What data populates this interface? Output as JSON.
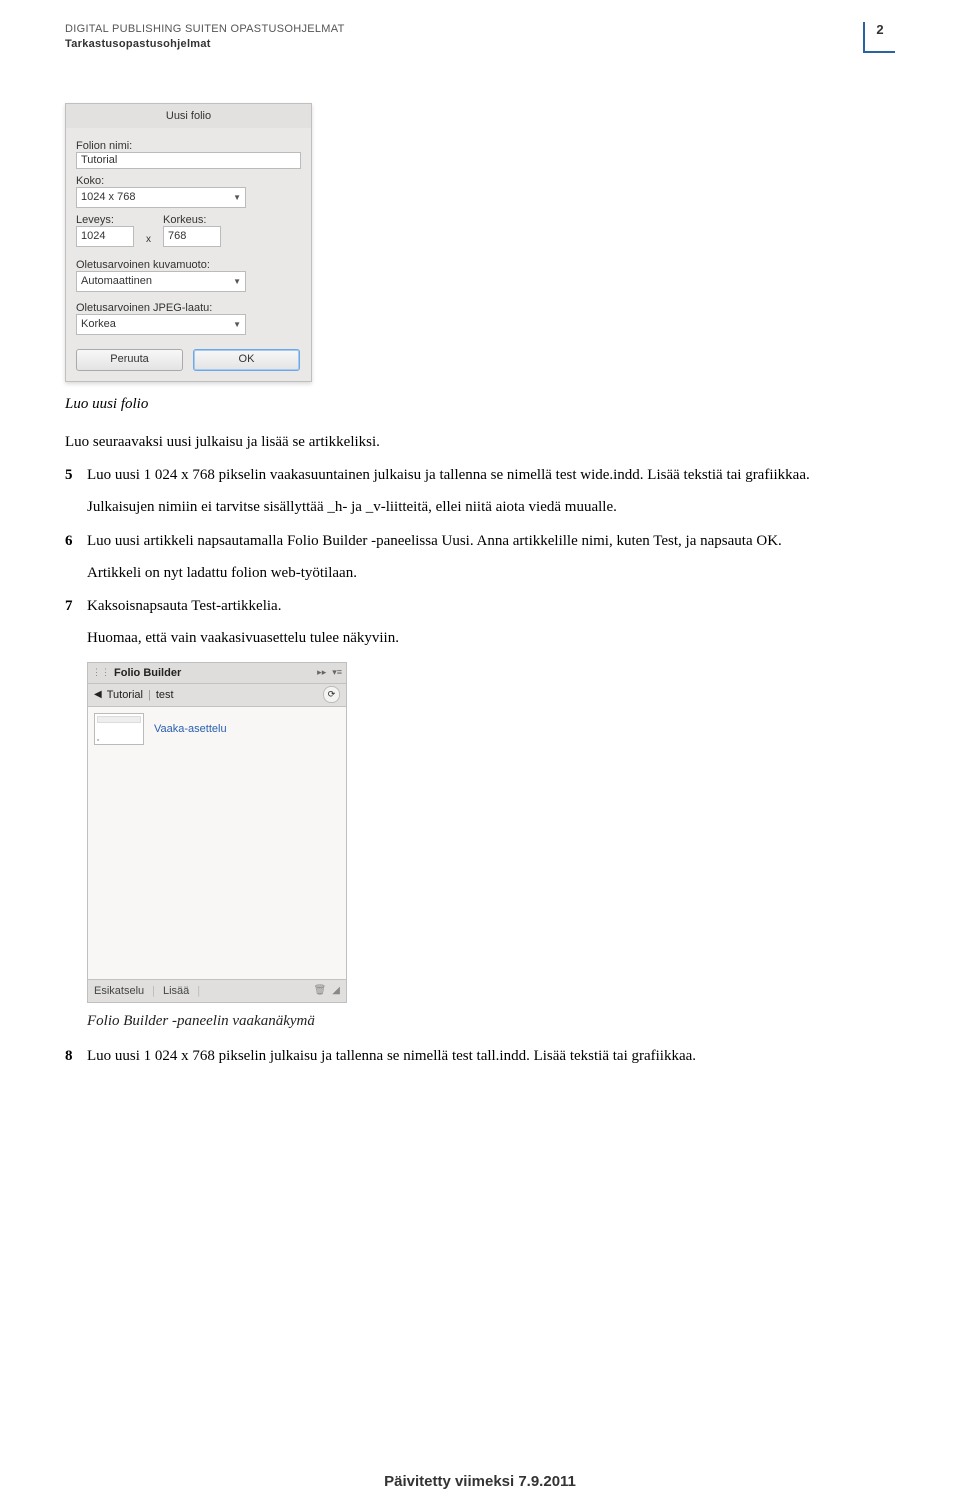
{
  "header": {
    "line1": "DIGITAL PUBLISHING SUITEN OPASTUSOHJELMAT",
    "line2": "Tarkastusopastusohjelmat",
    "page_number": "2"
  },
  "dialog": {
    "title": "Uusi folio",
    "name_label": "Folion nimi:",
    "name_value": "Tutorial",
    "size_label": "Koko:",
    "size_value": "1024 x 768",
    "width_label": "Leveys:",
    "height_label": "Korkeus:",
    "width_value": "1024",
    "height_value": "768",
    "times": "x",
    "format_label": "Oletusarvoinen kuvamuoto:",
    "format_value": "Automaattinen",
    "quality_label": "Oletusarvoinen JPEG-laatu:",
    "quality_value": "Korkea",
    "cancel": "Peruuta",
    "ok": "OK"
  },
  "captions": {
    "c1": "Luo uusi folio",
    "c2": "Folio Builder -paneelin vaakanäkymä"
  },
  "text": {
    "intro": "Luo seuraavaksi uusi julkaisu ja lisää se artikkeliksi.",
    "s5a": "Luo uusi 1 024 x 768 pikselin vaakasuuntainen julkaisu ja tallenna se nimellä test wide.indd. Lisää tekstiä tai grafiikkaa.",
    "s5b": "Julkaisujen nimiin ei tarvitse sisällyttää _h- ja _v-liitteitä, ellei niitä aiota viedä muualle.",
    "s6a": "Luo uusi artikkeli napsautamalla Folio Builder -paneelissa Uusi. Anna artikkelille nimi, kuten Test, ja napsauta OK.",
    "s6b": "Artikkeli on nyt ladattu folion web-työtilaan.",
    "s7a": "Kaksoisnapsauta Test-artikkelia.",
    "s7b": "Huomaa, että vain vaakasivuasettelu tulee näkyviin.",
    "s8": "Luo uusi 1 024 x 768 pikselin julkaisu ja tallenna se nimellä test tall.indd. Lisää tekstiä tai grafiikkaa."
  },
  "steps": {
    "n5": "5",
    "n6": "6",
    "n7": "7",
    "n8": "8"
  },
  "panel": {
    "title": "Folio Builder",
    "crumb1": "Tutorial",
    "crumb2": "test",
    "layout_label": "Vaaka-asettelu",
    "footer_preview": "Esikatselu",
    "footer_add": "Lisää"
  },
  "footer": {
    "updated": "Päivitetty viimeksi 7.9.2011"
  }
}
